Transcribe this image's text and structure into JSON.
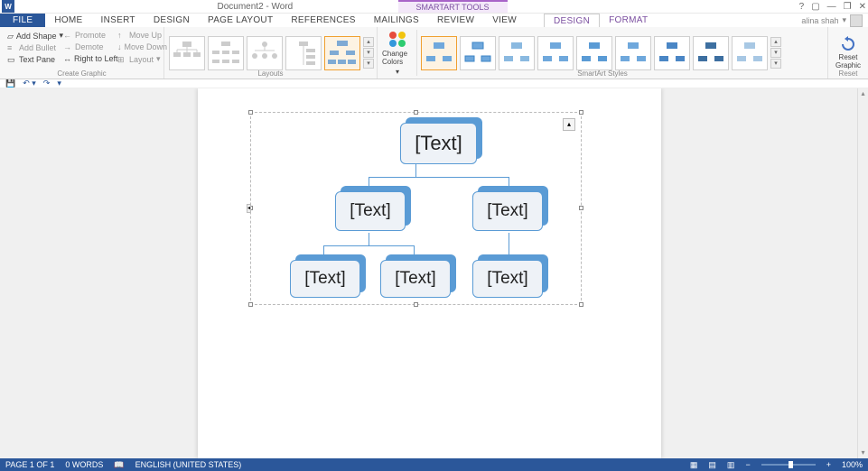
{
  "title": "Document2 - Word",
  "contextual_tools": "SMARTART TOOLS",
  "user": "alina shah",
  "tabs": {
    "file": "FILE",
    "home": "HOME",
    "insert": "INSERT",
    "design": "DESIGN",
    "page_layout": "PAGE LAYOUT",
    "references": "REFERENCES",
    "mailings": "MAILINGS",
    "review": "REVIEW",
    "view": "VIEW",
    "ctx_design": "DESIGN",
    "ctx_format": "FORMAT"
  },
  "ribbon": {
    "create_graphic": {
      "label": "Create Graphic",
      "add_shape": "Add Shape",
      "add_bullet": "Add Bullet",
      "text_pane": "Text Pane",
      "promote": "Promote",
      "demote": "Demote",
      "rtl": "Right to Left",
      "move_up": "Move Up",
      "move_down": "Move Down",
      "layout": "Layout"
    },
    "layouts": {
      "label": "Layouts"
    },
    "change_colors": "Change Colors",
    "styles": {
      "label": "SmartArt Styles"
    },
    "reset": {
      "label": "Reset",
      "button": "Reset Graphic"
    }
  },
  "smartart": {
    "placeholder": "[Text]"
  },
  "statusbar": {
    "page": "PAGE 1 OF 1",
    "words": "0 WORDS",
    "lang": "ENGLISH (UNITED STATES)",
    "zoom": "100%"
  }
}
